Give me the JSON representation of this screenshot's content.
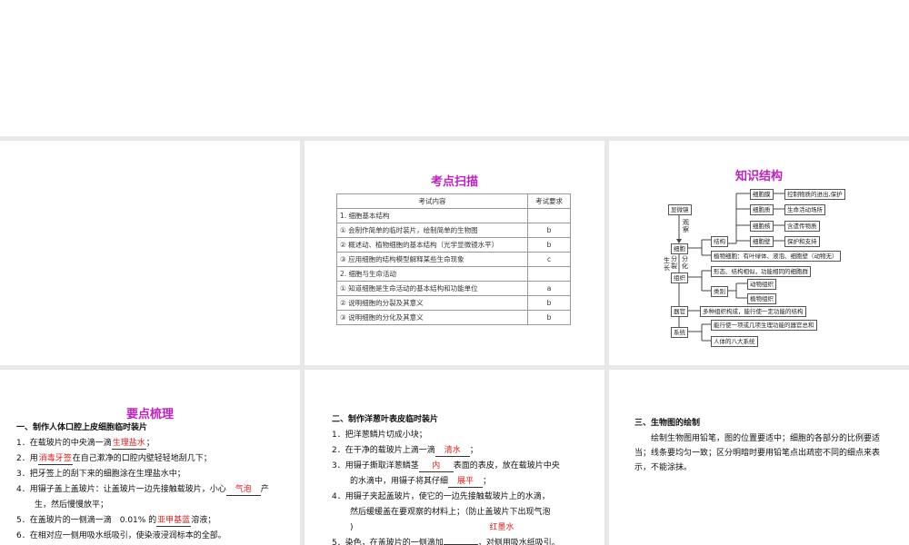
{
  "slide2": {
    "title": "考点扫描",
    "header": [
      "考试内容",
      "考试要求"
    ],
    "rows": [
      [
        "1. 细胞基本结构",
        ""
      ],
      [
        "① 会制作简单的临时装片，绘制简单的生物图",
        "b"
      ],
      [
        "② 概述动、植物细胞的基本结构（光学显微镜水平）",
        "b"
      ],
      [
        "③ 应用细胞的结构模型解释某些生命现象",
        "c"
      ],
      [
        "2. 细胞与生命活动",
        ""
      ],
      [
        "① 知道细胞是生命活动的基本结构和功能单位",
        "a"
      ],
      [
        "② 说明细胞的分裂及其意义",
        "b"
      ],
      [
        "③ 说明细胞的分化及其意义",
        "b"
      ]
    ]
  },
  "slide3": {
    "title": "知识结构",
    "microscope": "显微镜",
    "observe": "观察",
    "cell": "细胞",
    "structure": "结构",
    "membrane": "细胞膜",
    "membrane_fn": "控制物质的进出,保护",
    "cytoplasm": "细胞质",
    "cytoplasm_fn": "生命活动场所",
    "nucleus": "细胞核",
    "nucleus_fn": "含遗传物质",
    "wall": "细胞壁",
    "wall_fn": "保护和支持",
    "plant_cell": "植物细胞：有叶绿体、液泡、细胞壁（动物无）",
    "growth": "生长",
    "division": "分裂",
    "differentiation": "分化",
    "tissue": "组织",
    "tissue_def": "形态、结构相似，功能相同的细胞群",
    "category": "类别",
    "animal_tissue": "动物组织",
    "plant_tissue": "植物组织",
    "organ": "器官",
    "organ_def": "多种组织构成，能行使一定功能的结构",
    "system": "系统",
    "system_def": "能行使一项或几项生理功能的器官总和",
    "human_systems": "人体的八大系统"
  },
  "slide4": {
    "title": "要点梳理",
    "heading": "一、制作人体口腔上皮细胞临时装片",
    "lines": [
      [
        {
          "t": "1．在载玻片的中央滴一滴"
        },
        {
          "b": "生理盐水"
        },
        {
          "t": "；"
        }
      ],
      [
        {
          "t": "2．用"
        },
        {
          "b": "消毒牙签"
        },
        {
          "t": "在自己漱净的口腔内壁轻轻地刮几下；"
        }
      ],
      [
        {
          "t": "3．把牙签上的刮下来的细胞涂在生理盐水中；"
        }
      ],
      [
        {
          "t": "4．用镊子盖上盖玻片：让盖玻片一边先接触载玻片，小心"
        },
        {
          "b": "气泡"
        },
        {
          "t": "产"
        }
      ],
      [
        {
          "t": "生，然后慢慢放平；",
          "i": true
        }
      ],
      [
        {
          "t": "5．在盖玻片的一侧滴一滴　0.01% 的"
        },
        {
          "b": "亚甲基蓝"
        },
        {
          "t": "溶液；"
        }
      ],
      [
        {
          "t": "6．在相对应一侧用吸水纸吸引，使染液浸润标本的全部。"
        }
      ]
    ]
  },
  "slide5": {
    "heading": "二、制作洋葱叶表皮临时装片",
    "lines": [
      [
        {
          "t": "1．把洋葱鳞片切成小块；"
        }
      ],
      [
        {
          "t": "2．在干净的载玻片上滴一滴"
        },
        {
          "b": "清水"
        },
        {
          "t": "；"
        }
      ],
      [
        {
          "t": "3．用镊子撕取洋葱鳞茎"
        },
        {
          "b": "内"
        },
        {
          "t": "表面的表皮，放在载玻片中央"
        }
      ],
      [
        {
          "t": "的水滴中，用镊子将其仔细",
          "i": true
        },
        {
          "b": "展平"
        },
        {
          "t": "；"
        }
      ],
      [
        {
          "t": "4．用镊子夹起盖玻片，使它的一边先接触载玻片上的水滴，"
        }
      ],
      [
        {
          "t": "然后缓缓盖在要观察的材料上；（防止盖玻片下出现气泡",
          "i": true
        }
      ],
      [
        {
          "t": ")",
          "i": true
        },
        {
          "r": "红墨水"
        }
      ],
      [
        {
          "t": "5．染色，在盖玻片的一侧滴加"
        },
        {
          "b": ""
        },
        {
          "t": "，对侧用吸水纸吸引。"
        }
      ]
    ]
  },
  "slide6": {
    "heading": "三、生物图的绘制",
    "body": "绘制生物图用铅笔，图的位置要适中；细胞的各部分的比例要适当；线条要均匀一致；区分明暗时要用铅笔点出疏密不同的细点来表示，不能涂抹。"
  },
  "colors": {
    "title": "#c020c0",
    "answer": "#e02020"
  }
}
